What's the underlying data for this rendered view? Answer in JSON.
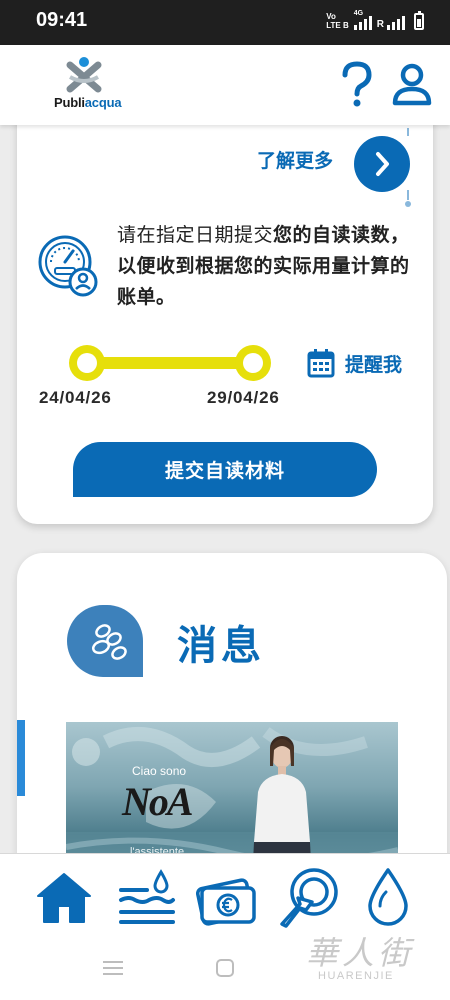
{
  "status_bar": {
    "time": "09:41",
    "volte_top": "Vo",
    "volte_bottom": "LTE B",
    "network": "4G",
    "roaming": "R",
    "battery_level": 0.5
  },
  "header": {
    "logo_text_part1": "Publi",
    "logo_text_part2": "acqua",
    "help_icon": "question-mark-icon",
    "user_icon": "user-icon"
  },
  "reading_card": {
    "learn_more_label": "了解更多",
    "description_normal": "请在指定日期提交",
    "description_bold": "您的自读读数，以便收到根据您的实际用量计算的账单。",
    "start_date": "24/04/26",
    "end_date": "29/04/26",
    "remind_label": "提醒我",
    "submit_label": "提交自读材料"
  },
  "messages_card": {
    "title": "消息",
    "promo_greeting": "Ciao sono",
    "promo_logo": "NoA",
    "promo_sub": "l'assistente"
  },
  "bottom_nav": [
    {
      "icon": "home-icon",
      "active": true
    },
    {
      "icon": "water-meter-readings-icon"
    },
    {
      "icon": "euro-bill-icon"
    },
    {
      "icon": "tap-report-icon"
    },
    {
      "icon": "water-drop-icon"
    }
  ],
  "watermark": {
    "chinese": "華人街",
    "latin": "HUARENJIE"
  },
  "colors": {
    "primary": "#0a6ab5",
    "accent_yellow": "#e6df0b",
    "bubble": "#3d81bb"
  }
}
